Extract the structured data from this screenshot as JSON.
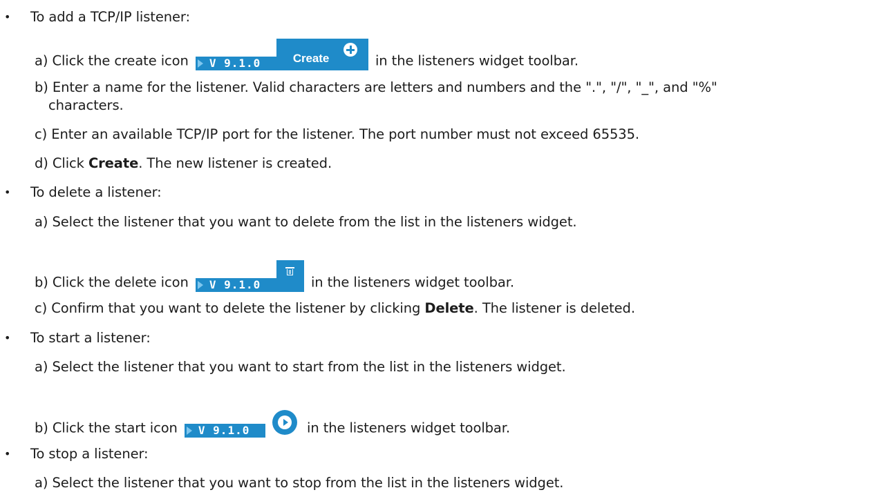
{
  "version_badge": "V 9.1.0",
  "bullets": [
    {
      "text": "To add a TCP/IP listener:"
    },
    {
      "text": "To delete a listener:"
    },
    {
      "text": "To start a listener:"
    },
    {
      "text": "To stop a listener:"
    }
  ],
  "add": {
    "a_pre": "a) Click the create icon",
    "a_post": "in the listeners widget toolbar.",
    "create_label": "Create",
    "b_line1": "b) Enter a name for the listener. Valid characters are letters and numbers and the \".\", \"/\", \"_\", and \"%\"",
    "b_line2": "characters.",
    "c": "c) Enter an available TCP/IP port for the listener. The port number must not exceed 65535.",
    "d_pre": "d) Click ",
    "d_bold": "Create",
    "d_post": ". The new listener is created."
  },
  "delete": {
    "a": "a) Select the listener that you want to delete from the list in the listeners widget.",
    "b_pre": "b) Click the delete icon",
    "b_post": "in the listeners widget toolbar.",
    "c_pre": "c) Confirm that you want to delete the listener by clicking ",
    "c_bold": "Delete",
    "c_post": ". The listener is deleted."
  },
  "start": {
    "a": "a) Select the listener that you want to start from the list in the listeners widget.",
    "b_pre": "b) Click the start icon",
    "b_post": "in the listeners widget toolbar."
  },
  "stop": {
    "a": "a) Select the listener that you want to stop from the list in the listeners widget."
  },
  "colors": {
    "badge_blue": "#1f8bc9",
    "text": "#1c1c1c"
  }
}
